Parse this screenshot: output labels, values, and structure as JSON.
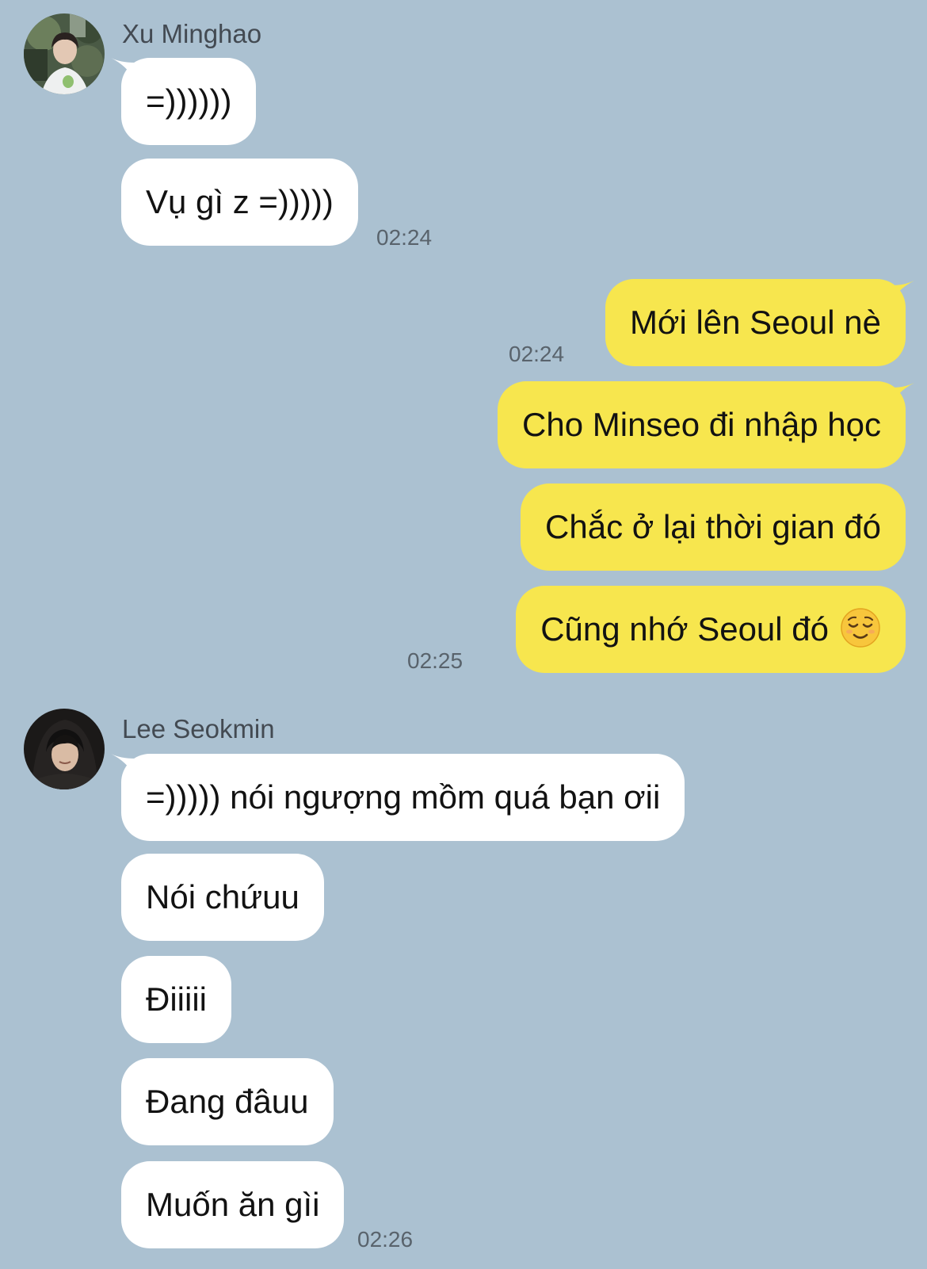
{
  "colors": {
    "background": "#abc1d1",
    "incoming_bubble": "#ffffff",
    "outgoing_bubble": "#f7e64e",
    "timestamp": "#59636c",
    "sender_name": "#434a52"
  },
  "groups": [
    {
      "sender": "Xu Minghao",
      "avatar_icon": "profile-photo-icon",
      "messages": [
        "=))))))",
        "Vụ gì z =)))))"
      ],
      "time": "02:24"
    },
    {
      "sender": "me",
      "messages": [
        "Mới lên Seoul nè"
      ],
      "time": "02:24"
    },
    {
      "sender": "me",
      "messages": [
        "Cho Minseo đi nhập học",
        "Chắc ở lại thời gian đó",
        "Cũng nhớ Seoul đó"
      ],
      "emoji": "relieved-face-emoji",
      "time": "02:25"
    },
    {
      "sender": "Lee Seokmin",
      "avatar_icon": "profile-photo-icon",
      "messages": [
        "=))))) nói ngượng mồm quá bạn ơii",
        "Nói chứuu",
        "Điiiii",
        "Đang đâuu",
        "Muốn ăn gìi"
      ],
      "time": "02:26"
    }
  ]
}
